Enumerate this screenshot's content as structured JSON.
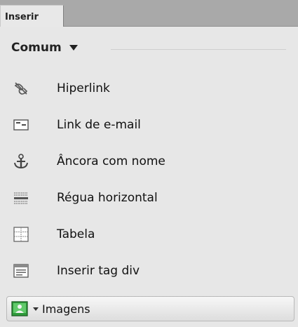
{
  "panel": {
    "tab_label": "Inserir",
    "category_label": "Comum",
    "items": [
      {
        "label": "Hiperlink",
        "icon": "hyperlink-icon"
      },
      {
        "label": "Link de e-mail",
        "icon": "email-link-icon"
      },
      {
        "label": "Âncora com nome",
        "icon": "anchor-icon"
      },
      {
        "label": "Régua horizontal",
        "icon": "horizontal-rule-icon"
      },
      {
        "label": "Tabela",
        "icon": "table-icon"
      },
      {
        "label": "Inserir tag div",
        "icon": "div-tag-icon"
      },
      {
        "label": "Imagens",
        "icon": "image-icon"
      }
    ]
  }
}
